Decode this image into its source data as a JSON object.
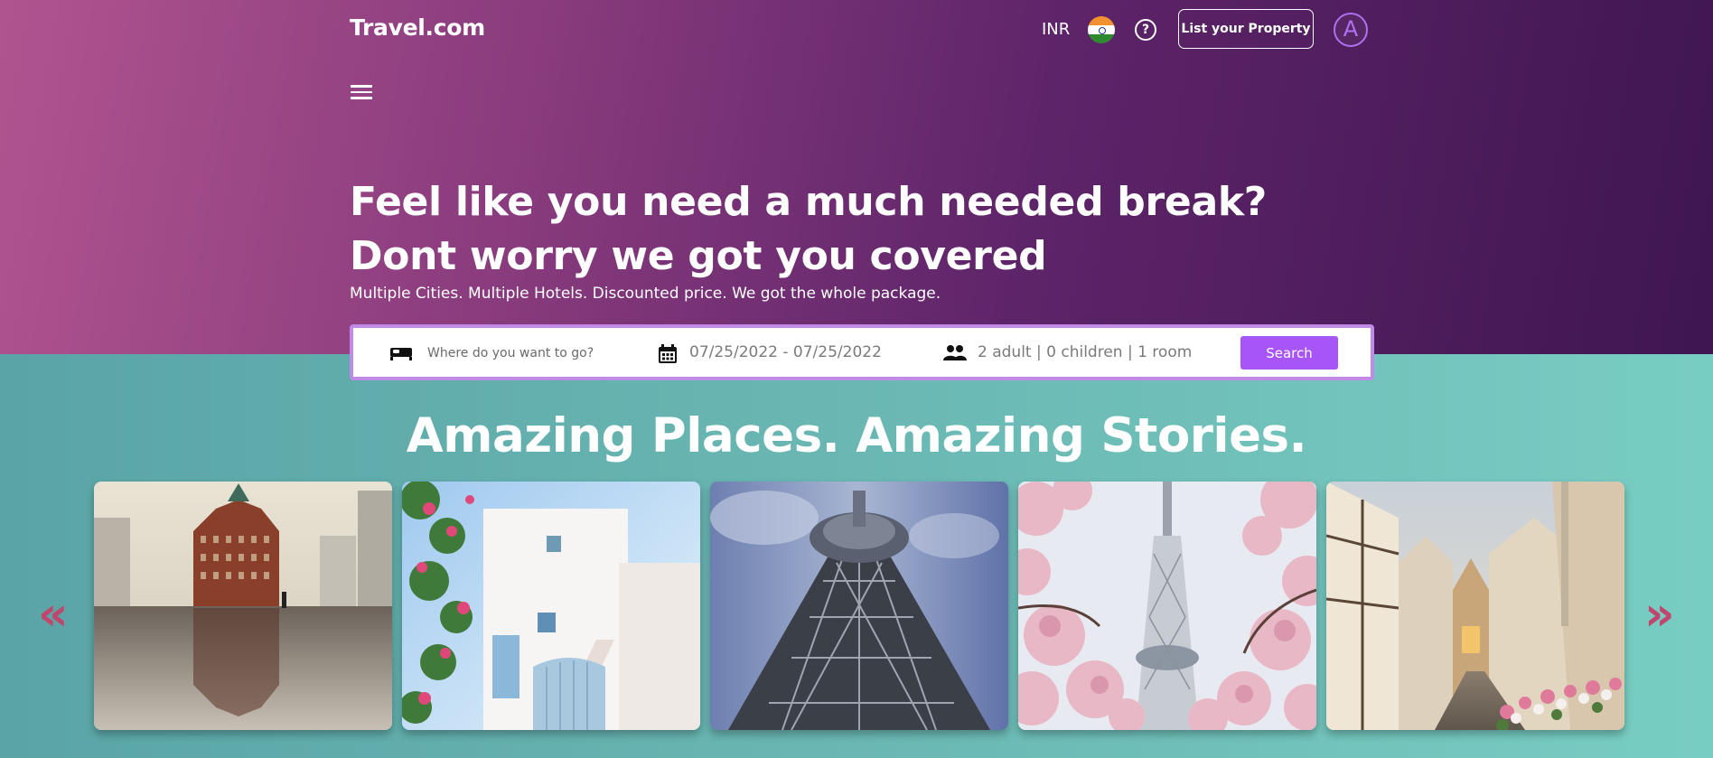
{
  "header": {
    "logo": "Travel.com",
    "currency": "INR",
    "flag_icon": "india-flag-icon",
    "help_icon": "question-circle-icon",
    "list_property_label": "List your Property",
    "avatar_initial": "A"
  },
  "hero": {
    "headline": "Feel like you need a much needed break? Dont worry we got you covered",
    "subline": "Multiple Cities. Multiple Hotels. Discounted price. We got the whole package."
  },
  "search": {
    "destination_placeholder": "Where do you want to go?",
    "destination_icon": "bed-icon",
    "dates": "07/25/2022 - 07/25/2022",
    "dates_icon": "calendar-icon",
    "guests": "2 adult | 0 children | 1 room",
    "guests_icon": "people-icon",
    "button_label": "Search"
  },
  "places": {
    "title": "Amazing Places. Amazing Stories.",
    "prev_label": "«",
    "next_label": "»",
    "cards": [
      {
        "subject": "city-street-flatiron-building-photo"
      },
      {
        "subject": "white-house-with-flowers-photo"
      },
      {
        "subject": "tower-looking-up-photo"
      },
      {
        "subject": "tower-with-cherry-blossoms-photo"
      },
      {
        "subject": "old-town-street-photo"
      }
    ]
  },
  "colors": {
    "accent": "#a855f7",
    "hero_gradient_start": "#b0548f",
    "hero_gradient_end": "#3f1650",
    "lower_bg": "#6ab7b3",
    "arrow": "#c0466e"
  }
}
